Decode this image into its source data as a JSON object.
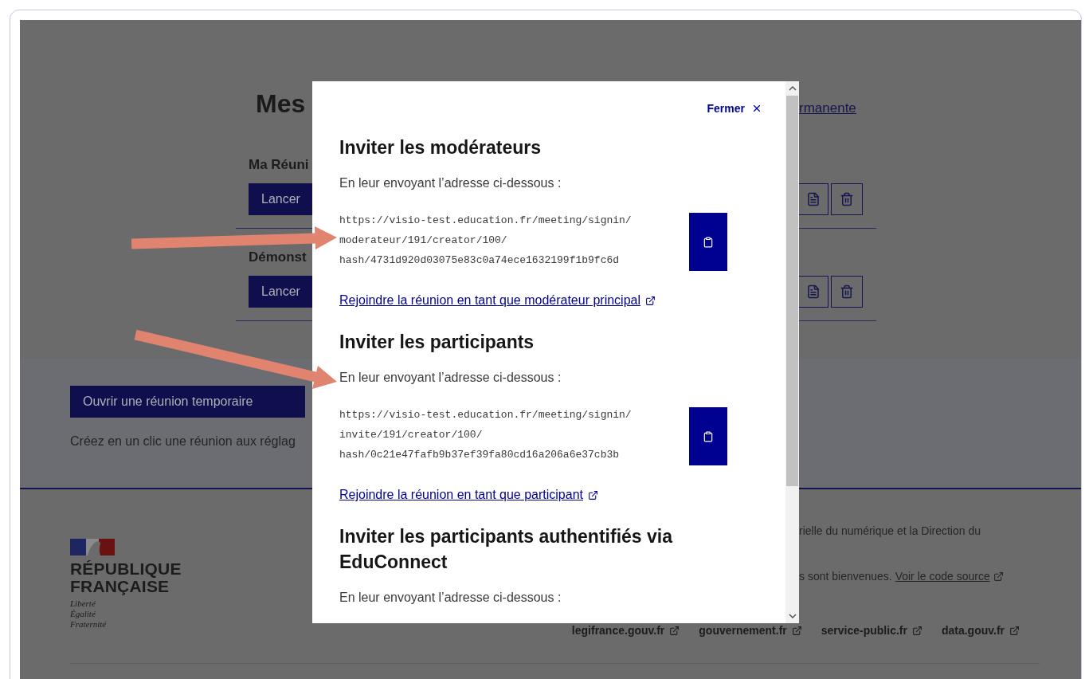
{
  "page": {
    "heading": "Mes",
    "permanent_link": "rmanente",
    "meetings": [
      {
        "title": "Ma Réuni",
        "launch": "Lancer"
      },
      {
        "title": "Démonst",
        "launch": "Lancer"
      }
    ],
    "temporary": {
      "button": "Ouvrir une réunion temporaire",
      "description": "Créez en un clic une réunion aux réglag"
    },
    "footer": {
      "brand": [
        "RÉPUBLIQUE",
        "FRANÇAISE"
      ],
      "motto": [
        "Liberté",
        "Égalité",
        "Fraternité"
      ],
      "description": "rielle du numérique et la Direction du",
      "contribution": "s sont bienvenues.",
      "source_link": "Voir le code source",
      "links": [
        "legifrance.gouv.fr",
        "gouvernement.fr",
        "service-public.fr",
        "data.gouv.fr"
      ]
    }
  },
  "modal": {
    "close": "Fermer",
    "sections": [
      {
        "title": "Inviter les modérateurs",
        "text": "En leur envoyant l’adresse ci-dessous :",
        "url_lines": [
          "https://visio-test.education.fr/meeting/signin/",
          "moderateur/191/creator/100/",
          "hash/4731d920d03075e83c0a74ece1632199f1b9fc6d"
        ],
        "link": "Rejoindre la réunion en tant que modérateur principal"
      },
      {
        "title": "Inviter les participants",
        "text": "En leur envoyant l’adresse ci-dessous :",
        "url_lines": [
          "https://visio-test.education.fr/meeting/signin/",
          "invite/191/creator/100/",
          "hash/0c21e47fafb9b37ef39fa80cd16a206a6e37cb3b"
        ],
        "link": "Rejoindre la réunion en tant que participant"
      },
      {
        "title": "Inviter les participants authentifiés via EduConnect",
        "text": "En leur envoyant l’adresse ci-dessous :"
      }
    ]
  }
}
